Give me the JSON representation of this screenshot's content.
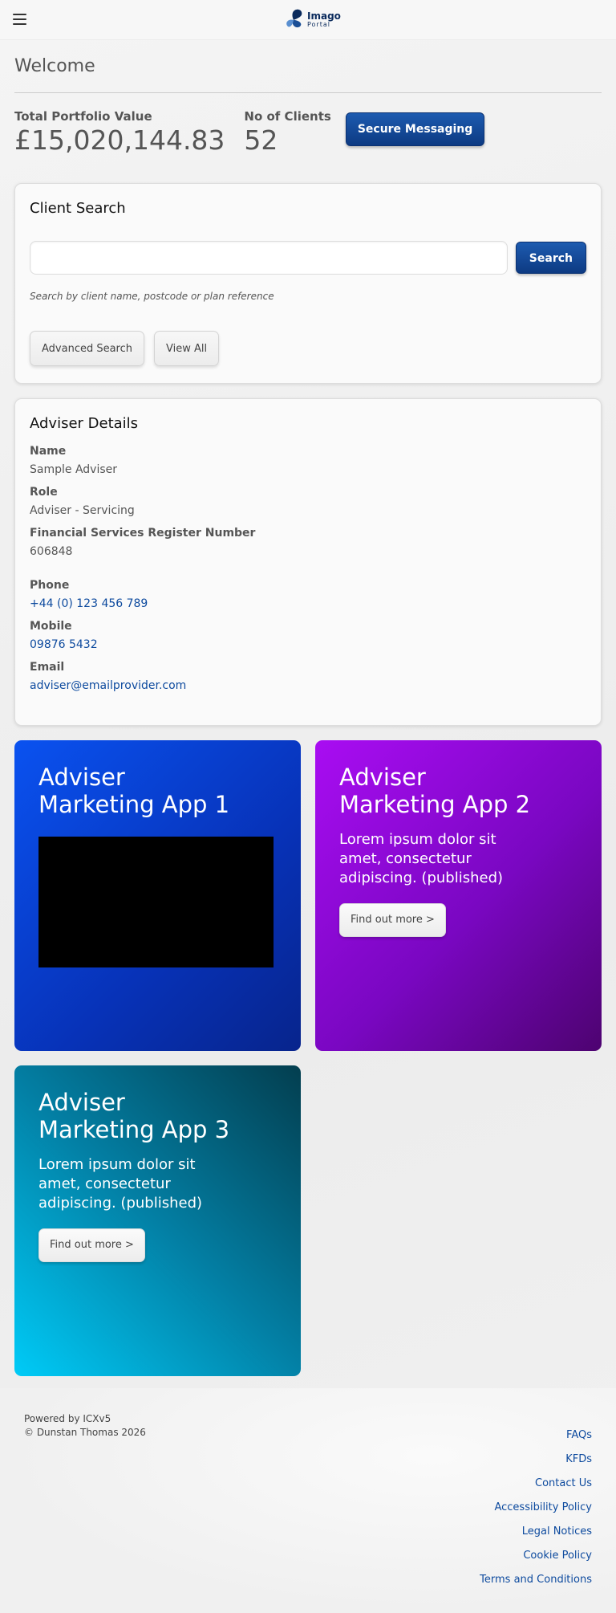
{
  "header": {
    "logo_main": "Imago",
    "logo_sub": "Portal"
  },
  "welcome": "Welcome",
  "stats": {
    "portfolio_label": "Total Portfolio Value",
    "portfolio_value": "£15,020,144.83",
    "clients_label": "No of Clients",
    "clients_value": "52",
    "secure_messaging_label": "Secure Messaging"
  },
  "client_search": {
    "title": "Client Search",
    "input_value": "",
    "search_label": "Search",
    "hint": "Search by client name, postcode or plan reference",
    "advanced_label": "Advanced Search",
    "view_all_label": "View All"
  },
  "adviser": {
    "title": "Adviser Details",
    "name_label": "Name",
    "name_value": "Sample Adviser",
    "role_label": "Role",
    "role_value": "Adviser - Servicing",
    "fsr_label": "Financial Services Register Number",
    "fsr_value": "606848",
    "phone_label": "Phone",
    "phone_value": "+44 (0) 123 456 789",
    "mobile_label": "Mobile",
    "mobile_value": "09876 5432",
    "email_label": "Email",
    "email_value": "adviser@emailprovider.com"
  },
  "tiles": [
    {
      "title_line1": "Adviser",
      "title_line2": "Marketing App 1"
    },
    {
      "title_line1": "Adviser",
      "title_line2": "Marketing App 2",
      "body": "Lorem ipsum dolor sit amet, consectetur adipiscing. (published)",
      "button": "Find out more >"
    },
    {
      "title_line1": "Adviser",
      "title_line2": "Marketing App 3",
      "body": "Lorem ipsum dolor sit amet, consectetur adipiscing. (published)",
      "button": "Find out more >"
    }
  ],
  "footer": {
    "powered_by": "Powered by ICXv5",
    "copyright": "© Dunstan Thomas 2026",
    "links": [
      "FAQs",
      "KFDs",
      "Contact Us",
      "Accessibility Policy",
      "Legal Notices",
      "Cookie Policy",
      "Terms and Conditions"
    ]
  },
  "colors": {
    "primary": "#0d3a82",
    "link": "#0d4a9e",
    "tile1": "#0a52f0",
    "tile2": "#a90df2",
    "tile3": "#00cbf7"
  }
}
